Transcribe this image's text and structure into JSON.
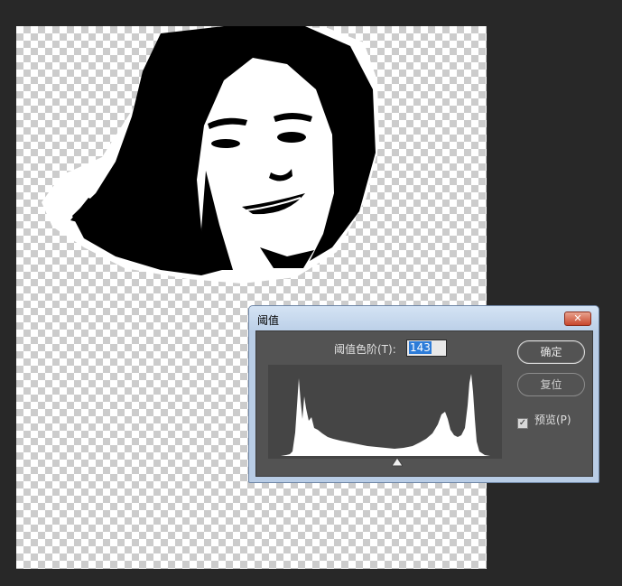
{
  "dialog": {
    "title": "阈值",
    "threshold_label": "阈值色阶(T):",
    "threshold_value": "143",
    "ok_label": "确定",
    "reset_label": "复位",
    "preview_label": "预览(P)",
    "preview_checked": true,
    "close_glyph": "✕"
  },
  "icons": {
    "close": "close-icon",
    "check": "check-icon",
    "slider": "slider-triangle-icon"
  },
  "colors": {
    "workspace_bg": "#282828",
    "dialog_body_bg": "#535353",
    "titlebar_bg": "#c4d6ec",
    "histogram_bg": "#454545",
    "histogram_fill": "#ffffff",
    "selection_blue": "#2d7cd8",
    "close_red": "#c8462c"
  }
}
